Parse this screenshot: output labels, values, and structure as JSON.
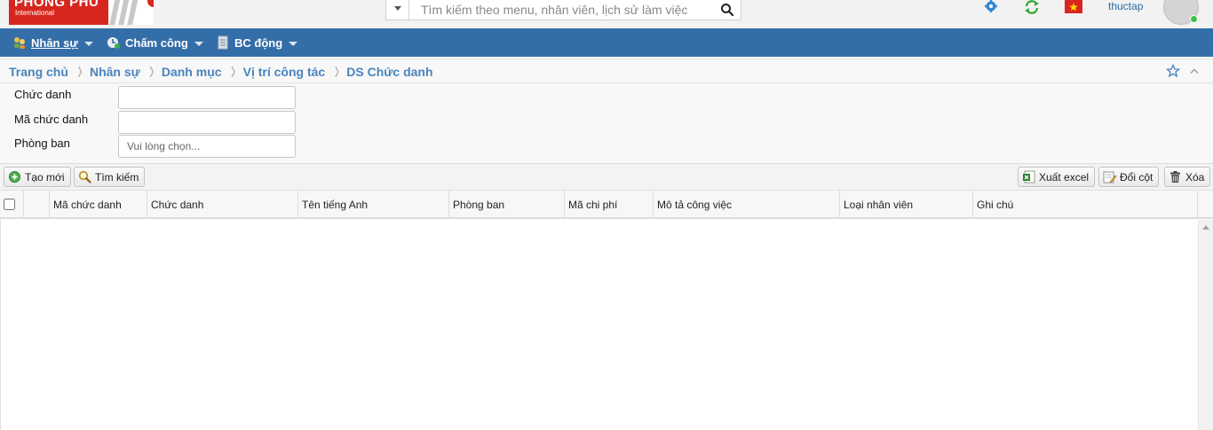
{
  "header": {
    "logo": {
      "brand": "PHONG PHU",
      "sub": "International"
    },
    "search": {
      "placeholder": "Tìm kiếm theo menu, nhân viên, lịch sử làm việc"
    },
    "icons": [
      "gear-icon",
      "refresh-icon",
      "vietnam-flag-icon",
      "search-icon"
    ],
    "user_name": "thuctap"
  },
  "nav": {
    "items": [
      {
        "label": "Nhân sự",
        "icon": "people-icon"
      },
      {
        "label": "Chấm công",
        "icon": "clock-icon"
      },
      {
        "label": "BC động",
        "icon": "report-icon"
      }
    ]
  },
  "breadcrumb": [
    "Trang chủ",
    "Nhân sự",
    "Danh mục",
    "Vị trí công tác",
    "DS Chức danh"
  ],
  "filters": {
    "chuc_danh_label": "Chức danh",
    "chuc_danh_value": "",
    "ma_chuc_danh_label": "Mã chức danh",
    "ma_chuc_danh_value": "",
    "phong_ban_label": "Phòng ban",
    "phong_ban_placeholder": "Vui lòng chọn..."
  },
  "toolbar": {
    "create_label": "Tạo mới",
    "search_label": "Tìm kiếm",
    "export_label": "Xuất excel",
    "columns_label": "Đổi cột",
    "delete_label": "Xóa"
  },
  "grid": {
    "columns": [
      "Mã chức danh",
      "Chức danh",
      "Tên tiếng Anh",
      "Phòng ban",
      "Mã chi phí",
      "Mô tả công việc",
      "Loại nhân viên",
      "Ghi chú"
    ],
    "rows": []
  },
  "colors": {
    "nav_bg": "#346ea8",
    "link": "#4a84be",
    "brand_red": "#d7261e"
  }
}
